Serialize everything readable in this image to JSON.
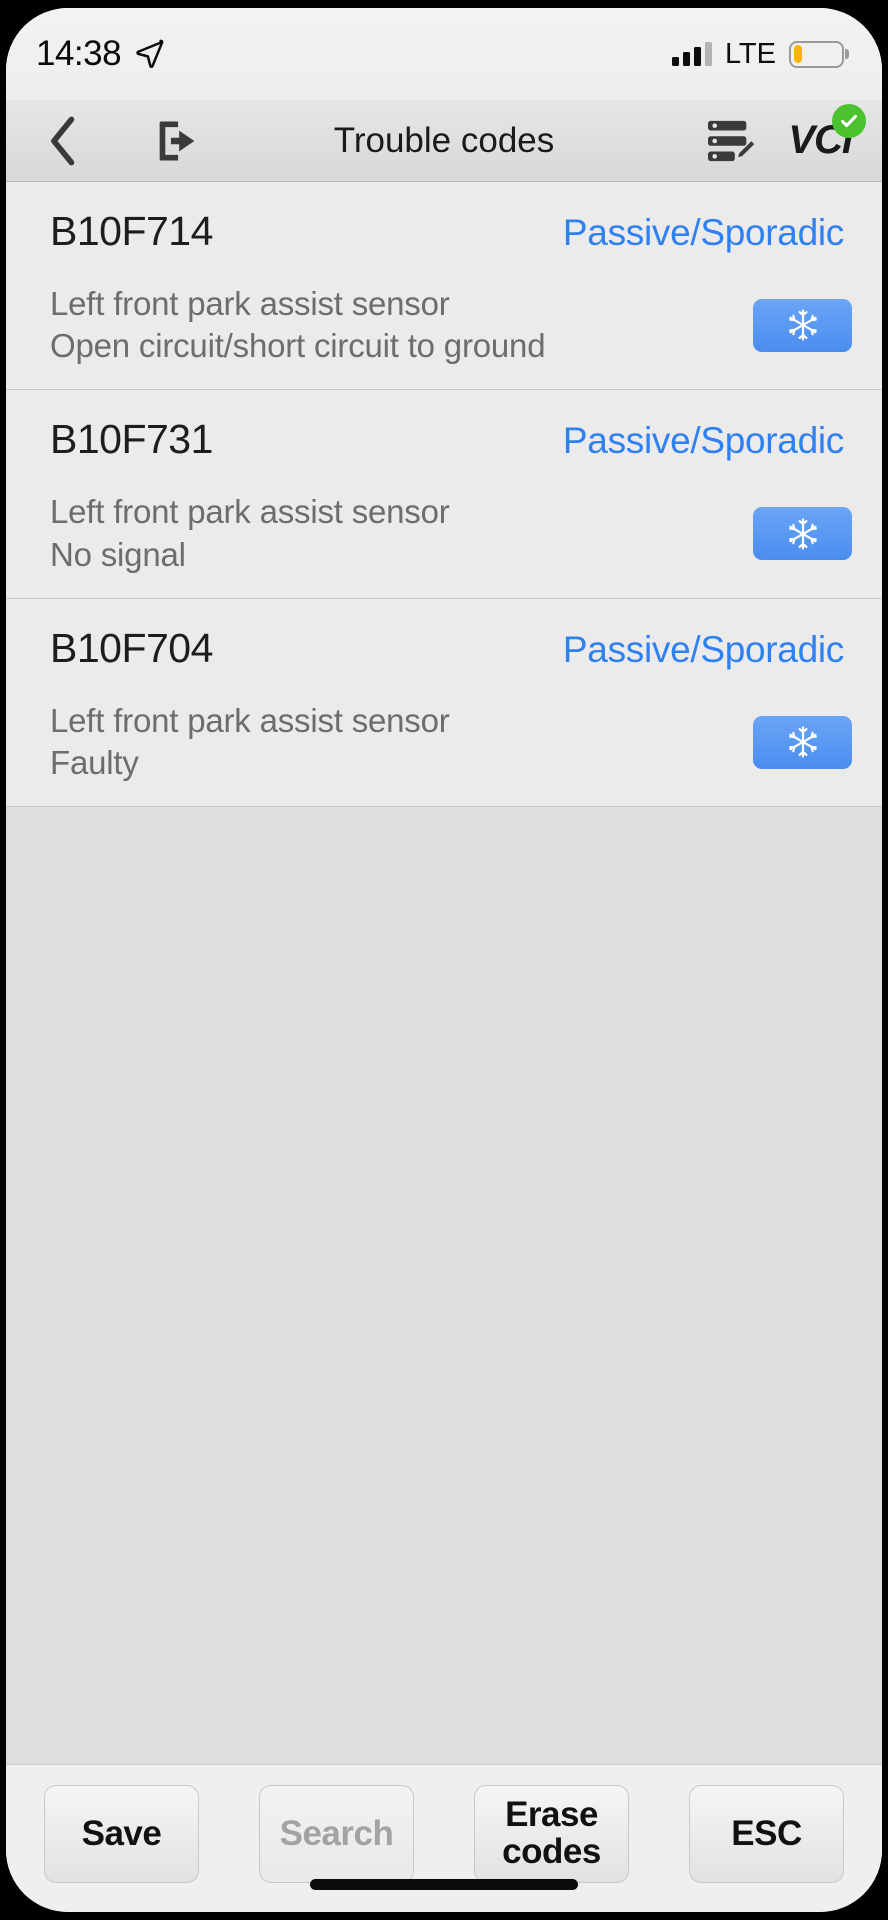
{
  "status_bar": {
    "time": "14:38",
    "location_icon": "location-arrow-icon",
    "signal_icon": "cellular-signal-icon",
    "signal_bars_filled": 3,
    "signal_bars_total": 4,
    "network": "LTE",
    "battery_icon": "battery-low-icon",
    "battery_level_percent": 18,
    "battery_color": "#f7b500"
  },
  "nav_bar": {
    "back_icon": "chevron-left-icon",
    "exit_icon": "exit-app-icon",
    "title": "Trouble codes",
    "report_icon": "list-edit-icon",
    "vci_label": "VCI",
    "vci_status_icon": "check-circle-icon",
    "vci_status_color": "#4cc32e"
  },
  "trouble_codes": [
    {
      "code": "B10F714",
      "status": "Passive/Sporadic",
      "description_line1": "Left front park assist sensor",
      "description_line2": "Open circuit/short circuit to ground",
      "freeze_frame_icon": "snowflake-icon"
    },
    {
      "code": "B10F731",
      "status": "Passive/Sporadic",
      "description_line1": "Left front park assist sensor",
      "description_line2": "No signal",
      "freeze_frame_icon": "snowflake-icon"
    },
    {
      "code": "B10F704",
      "status": "Passive/Sporadic",
      "description_line1": "Left front park assist sensor",
      "description_line2": "Faulty",
      "freeze_frame_icon": "snowflake-icon"
    }
  ],
  "bottom_bar": {
    "save": "Save",
    "search": "Search",
    "erase_line1": "Erase",
    "erase_line2": "codes",
    "esc": "ESC"
  },
  "colors": {
    "status_blue": "#2f80f0",
    "freeze_button": "#4a8df0",
    "row_bg": "#ebebeb",
    "page_bg": "#dedede"
  }
}
